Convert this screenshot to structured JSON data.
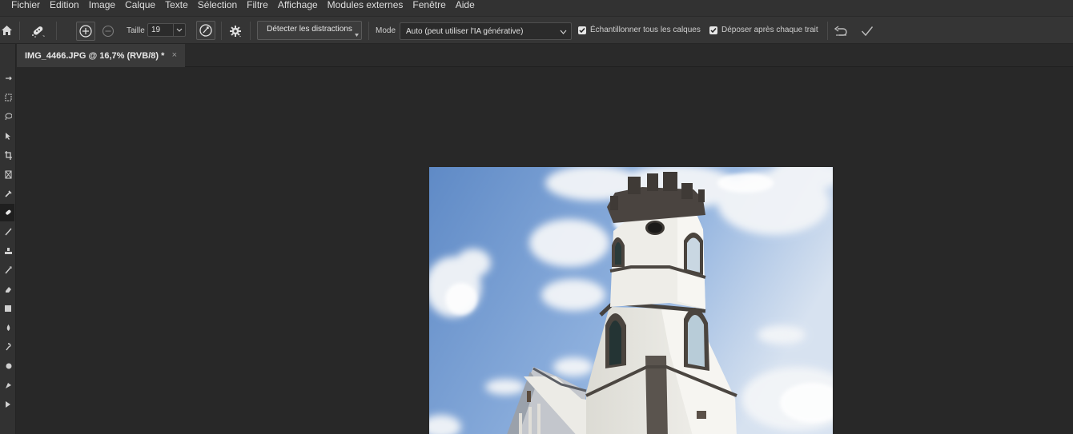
{
  "menu": [
    "Fichier",
    "Edition",
    "Image",
    "Calque",
    "Texte",
    "Sélection",
    "Filtre",
    "Affichage",
    "Modules externes",
    "Fenêtre",
    "Aide"
  ],
  "options": {
    "size_label": "Taille",
    "size_value": "19",
    "detect_button": "Détecter les distractions",
    "mode_label": "Mode",
    "mode_value": "Auto (peut utiliser l'IA générative)",
    "sample_all_label": "Échantillonner tous les calques",
    "sample_all_checked": true,
    "apply_each_stroke_label": "Déposer après chaque trait",
    "apply_each_stroke_checked": true
  },
  "document": {
    "tab_title": "IMG_4466.JPG @ 16,7% (RVB/8) *",
    "close_symbol": "×"
  },
  "icons": {
    "home": "home-icon",
    "tool_preset": "remove-tool-icon",
    "add_mode": "add-circle-icon",
    "subtract_mode": "subtract-circle-icon",
    "pressure": "pressure-size-icon",
    "settings": "gear-icon",
    "undo": "undo-icon",
    "confirm": "checkmark-icon"
  },
  "colors": {
    "menubar": "#323232",
    "optionsbar": "#353535",
    "canvas_bg": "#282828",
    "sky": "#7fa6d6",
    "tower_wall": "#ecebe6"
  }
}
